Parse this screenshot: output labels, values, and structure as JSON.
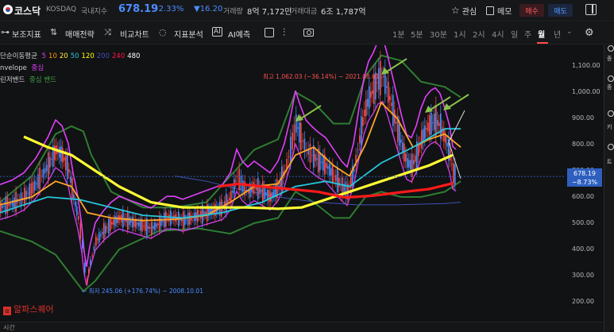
{
  "header": {
    "stock_name": "코스닥",
    "stock_code": "KOSDAQ",
    "category": "국내지수",
    "price": "678.19",
    "change_pct": "-2.33%",
    "change_abs": "▼16.20",
    "volume_label": "거래량",
    "volume_value": "8억 7,172만",
    "amount_label": "거래대금",
    "amount_value": "6조 1,787억",
    "watch_label": "관심",
    "memo_label": "메모",
    "buy_label": "매수",
    "sell_label": "매도"
  },
  "toolbar": {
    "indicators_label": "보조지표",
    "strategy_label": "매매전략",
    "compare_label": "비교차트",
    "analysis_label": "지표분석",
    "ai_label": "AI예측",
    "timeframes": [
      "1분",
      "5분",
      "30분",
      "1시",
      "2시",
      "4시",
      "일",
      "주",
      "월",
      "년"
    ],
    "active_timeframe": "월",
    "more_icon": "⌄"
  },
  "legend": {
    "ma_label": "단순이동평균",
    "ma_periods": [
      "5",
      "10",
      "20",
      "50",
      "120",
      "200",
      "240",
      "480"
    ],
    "ma_colors": [
      "#e040fb",
      "#ff9800",
      "#ffeb3b",
      "#26c6da",
      "#ffff00",
      "#3f51b5",
      "#ff1744",
      "#ffffff"
    ],
    "envelope_label": "nvelope",
    "envelope_mid": "중심",
    "bollinger_label": "린저밴드",
    "bollinger_mid": "중심 밴드"
  },
  "chart_data": {
    "type": "candlestick",
    "title": "",
    "ylim": [
      200,
      1150
    ],
    "yticks": [
      1100,
      1000,
      900,
      800,
      700,
      600,
      500,
      400,
      300,
      200
    ],
    "ytick_labels": [
      "1,100.00",
      "1,000.00",
      "900.00",
      "800.00",
      "700.00",
      "600.00",
      "500.00",
      "400.00",
      "300.00",
      "200.00"
    ],
    "annotations": {
      "high": "최고 1,062.03 (−36.14%) − 2021.08.01",
      "low": "← 최저 245.06 (+176.74%) − 2008.10.01"
    },
    "last_price": "678.19",
    "last_change": "−8.73%",
    "colors": {
      "up": "#ff4d4d",
      "down": "#4c8dff",
      "ma120": "#ffff33",
      "ma240": "#ff1a1a",
      "ma50": "#26c6da",
      "envelope": "#e040fb",
      "bollinger": "#2e7d32",
      "ma20": "#ffa726",
      "ma200": "#3f51b5"
    }
  },
  "watermark": "알파스퀘어",
  "right_panel": [
    "종",
    "종",
    "키",
    "트"
  ],
  "bottom": {
    "text": "시간"
  }
}
